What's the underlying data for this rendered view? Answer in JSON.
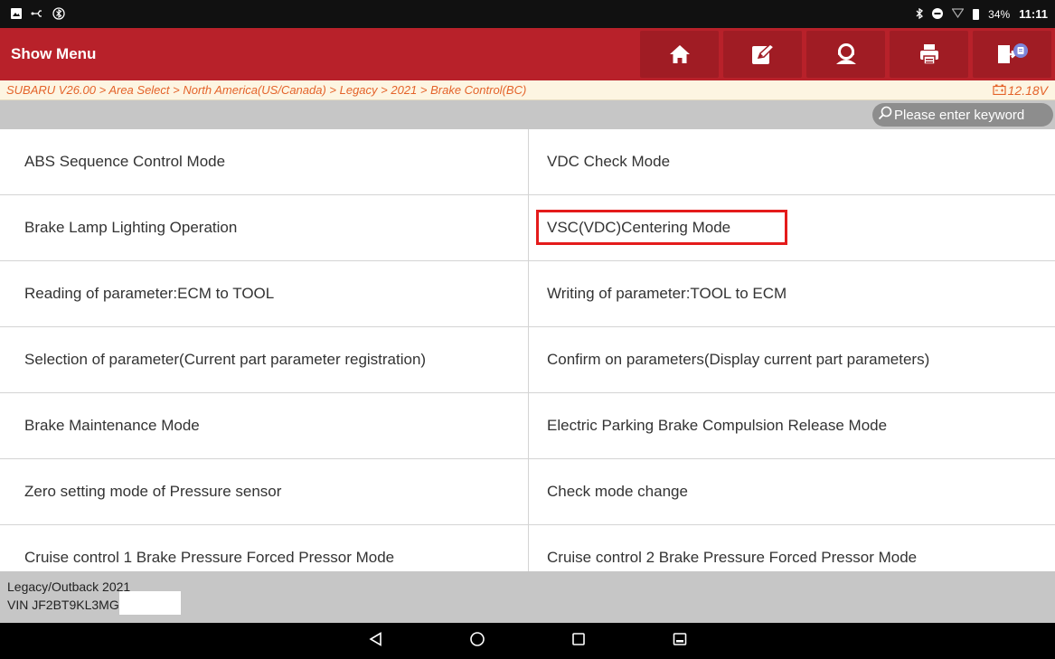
{
  "status_bar": {
    "battery_percent": "34%",
    "time": "11:11"
  },
  "header": {
    "title": "Show Menu",
    "buttons": [
      {
        "icon": "home-icon"
      },
      {
        "icon": "edit-report-icon"
      },
      {
        "icon": "remote-support-icon"
      },
      {
        "icon": "print-icon"
      },
      {
        "icon": "exit-icon"
      }
    ]
  },
  "breadcrumb": {
    "path": "SUBARU V26.00 > Area Select > North America(US/Canada) > Legacy > 2021 > Brake Control(BC)",
    "voltage": "12.18V"
  },
  "search": {
    "placeholder": "Please enter keyword"
  },
  "menu": {
    "items": [
      {
        "label": "ABS Sequence Control Mode"
      },
      {
        "label": "VDC Check Mode"
      },
      {
        "label": "Brake Lamp Lighting Operation"
      },
      {
        "label": "VSC(VDC)Centering Mode"
      },
      {
        "label": "Reading of parameter:ECM to TOOL"
      },
      {
        "label": "Writing of parameter:TOOL to ECM"
      },
      {
        "label": "Selection of parameter(Current part parameter registration)"
      },
      {
        "label": "Confirm on parameters(Display current part parameters)"
      },
      {
        "label": "Brake Maintenance Mode"
      },
      {
        "label": "Electric Parking Brake Compulsion Release Mode"
      },
      {
        "label": "Zero setting mode of Pressure sensor"
      },
      {
        "label": "Check mode change"
      },
      {
        "label": "Cruise control 1 Brake Pressure Forced Pressor Mode"
      },
      {
        "label": "Cruise control 2 Brake Pressure Forced Pressor Mode"
      }
    ],
    "highlight_color": "#e41b1b"
  },
  "footer": {
    "vehicle": "Legacy/Outback 2021",
    "vin": "VIN JF2BT9KL3MG"
  },
  "colors": {
    "header_bg": "#b8212a",
    "breadcrumb_text": "#e4632a"
  }
}
